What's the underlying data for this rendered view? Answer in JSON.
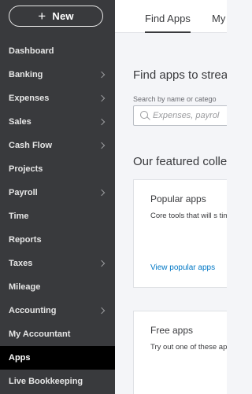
{
  "sidebar": {
    "new_button": {
      "icon": "plus-icon",
      "plus": "+",
      "label": "New"
    },
    "items": [
      {
        "label": "Dashboard",
        "chevron": false
      },
      {
        "label": "Banking",
        "chevron": true
      },
      {
        "label": "Expenses",
        "chevron": true
      },
      {
        "label": "Sales",
        "chevron": true
      },
      {
        "label": "Cash Flow",
        "chevron": true
      },
      {
        "label": "Projects",
        "chevron": false
      },
      {
        "label": "Payroll",
        "chevron": true
      },
      {
        "label": "Time",
        "chevron": false
      },
      {
        "label": "Reports",
        "chevron": false
      },
      {
        "label": "Taxes",
        "chevron": true
      },
      {
        "label": "Mileage",
        "chevron": false
      },
      {
        "label": "Accounting",
        "chevron": true
      },
      {
        "label": "My Accountant",
        "chevron": false
      },
      {
        "label": "Apps",
        "chevron": false,
        "active": true
      },
      {
        "label": "Live Bookkeeping",
        "chevron": false
      }
    ]
  },
  "main": {
    "tabs": [
      {
        "label": "Find Apps",
        "active": true
      },
      {
        "label": "My"
      }
    ],
    "find_heading": "Find apps to strea",
    "search": {
      "label": "Search by name or catego",
      "placeholder": "Expenses, payrol"
    },
    "featured_heading": "Our featured colle",
    "cards": [
      {
        "title": "Popular apps",
        "description": "Core tools that will s time, money and ma",
        "link": "View popular apps"
      },
      {
        "title": "Free apps",
        "description": "Try out one of these apps – no strings att"
      }
    ]
  },
  "colors": {
    "sidebar_bg": "#393a3d",
    "active_item_bg": "#000000",
    "link": "#0077c5",
    "page_bg": "#f4f5f8"
  }
}
